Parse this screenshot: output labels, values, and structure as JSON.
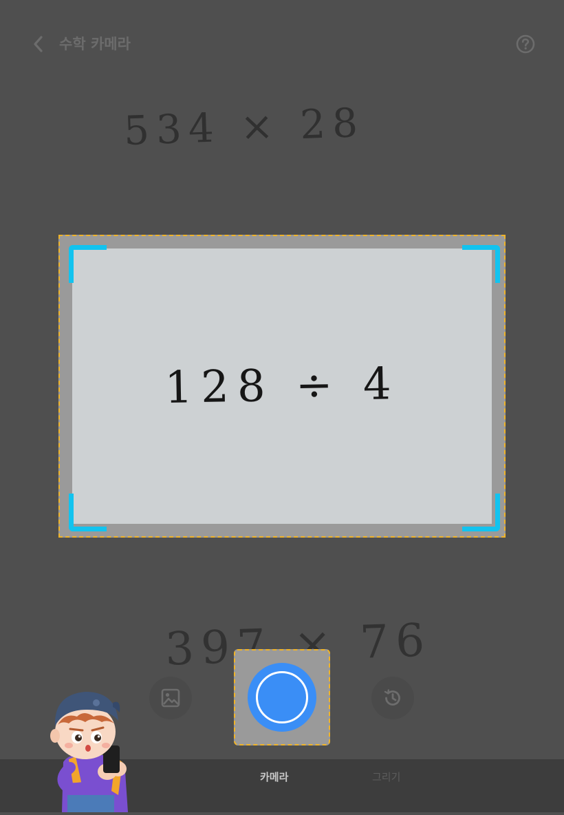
{
  "header": {
    "title": "수학 카메라",
    "back_icon": "chevron-left-icon",
    "help_icon": "question-circle-icon"
  },
  "background_problems": {
    "top": "534 × 28",
    "bottom": "397 × 76"
  },
  "scan": {
    "problem": "128 ÷ 4",
    "frame_color": "#12c3ef"
  },
  "controls": {
    "gallery_icon": "image-icon",
    "shutter_icon": "shutter-icon",
    "history_icon": "history-icon",
    "shutter_color": "#3a8ef6"
  },
  "tabs": {
    "camera": "카메라",
    "draw": "그리기"
  },
  "mascot": "boy-with-phone-mascot"
}
